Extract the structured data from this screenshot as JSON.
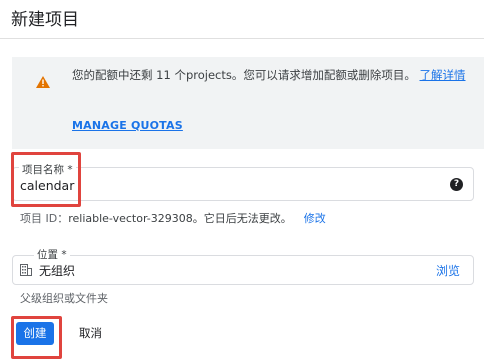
{
  "header": {
    "title": "新建项目"
  },
  "notice": {
    "text": "您的配额中还剩 11 个projects。您可以请求增加配额或删除项目。",
    "link_text": "了解详情",
    "manage_label": "MANAGE QUOTAS",
    "icon": "warning-icon",
    "accent_color": "#e37400"
  },
  "project_name": {
    "label": "项目名称 *",
    "value": "calendar",
    "help_icon": "help-icon",
    "help_symbol": "?"
  },
  "project_id": {
    "prefix": "项目 ID：",
    "value": "reliable-vector-329308。它日后无法更改。",
    "edit_label": "修改"
  },
  "location": {
    "label": "位置 *",
    "value": "无组织",
    "icon": "organization-icon",
    "browse_label": "浏览",
    "hint": "父级组织或文件夹"
  },
  "actions": {
    "create_label": "创建",
    "cancel_label": "取消",
    "primary_color": "#1a73e8"
  },
  "highlight_color": "#e0443e"
}
